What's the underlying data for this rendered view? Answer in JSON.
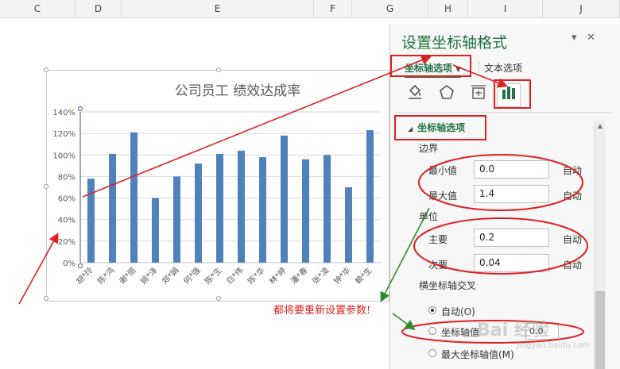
{
  "columns": [
    "C",
    "D",
    "E",
    "F",
    "G",
    "H",
    "I",
    "J"
  ],
  "chart": {
    "title": "公司员工 绩效达成率",
    "chart_data": {
      "type": "bar",
      "title": "公司员工 绩效达成率",
      "categories": [
        "胡*玲",
        "陈*鸿",
        "谢*丽",
        "姚*泽",
        "郑*娟",
        "何*强",
        "陈*生",
        "白*伟",
        "陈*华",
        "林*婷",
        "潘*春",
        "张*凌",
        "钟*华",
        "赖*生"
      ],
      "values": [
        0.78,
        1.01,
        1.21,
        0.6,
        0.8,
        0.92,
        1.01,
        1.04,
        0.98,
        1.18,
        0.96,
        1.0,
        0.7,
        1.23
      ],
      "y_ticks": [
        "0%",
        "20%",
        "40%",
        "60%",
        "80%",
        "100%",
        "120%",
        "140%"
      ],
      "ylim": [
        0,
        1.4
      ],
      "grid": true,
      "bar_color": "#4f81bd"
    }
  },
  "pane": {
    "title": "设置坐标轴格式",
    "pin": "▾",
    "close": "✕",
    "tab_axis": "坐标轴选项",
    "tab_text": "文本选项",
    "icons": [
      "paint-bucket-icon",
      "pentagon-icon",
      "size-properties-icon",
      "bar-chart-icon"
    ],
    "section": "坐标轴选项",
    "bounds_label": "边界",
    "min_label": "最小值",
    "min_value": "0.0",
    "max_label": "最大值",
    "max_value": "1.4",
    "auto": "自动",
    "units_label": "单位",
    "major_label": "主要",
    "major_value": "0.2",
    "minor_label": "次要",
    "minor_value": "0.04",
    "cross_label": "横坐标轴交叉",
    "opt_auto": "自动(O)",
    "opt_value": "坐标轴值",
    "opt_value_input": "0.0",
    "opt_max": "最大坐标轴值(M)"
  },
  "annotation": "都将要重新设置参数!",
  "watermark": "Bai 经验",
  "watermark_url": "jingyan.baidu.com",
  "accent": "#217346",
  "annot_color": "#e02020",
  "arrow_green": "#2e8b2e"
}
